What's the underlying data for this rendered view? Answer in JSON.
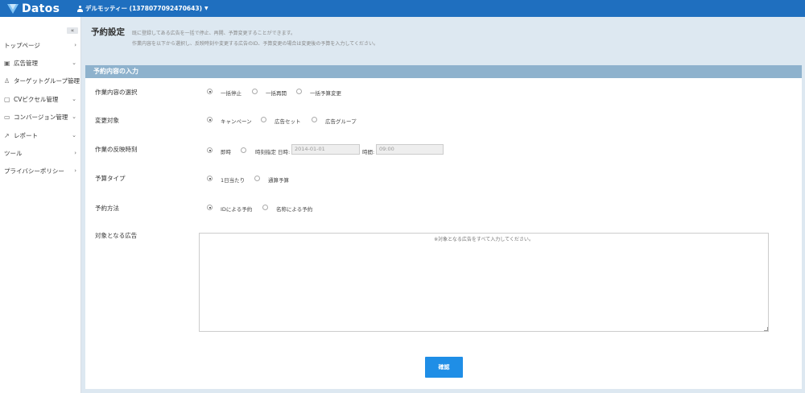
{
  "header": {
    "logo_text": "Datos",
    "account_label": "デルモッティー (1378077092470643)"
  },
  "sidebar": {
    "collapse_label": "«",
    "items": [
      {
        "label": "トップページ",
        "icon": "none"
      },
      {
        "label": "広告管理",
        "icon": "ad-icon"
      },
      {
        "label": "ターゲットグループ管理",
        "icon": "user-icon"
      },
      {
        "label": "CVピクセル管理",
        "icon": "pixel-icon"
      },
      {
        "label": "コンバージョン管理",
        "icon": "conversion-icon"
      },
      {
        "label": "レポート",
        "icon": "chart-icon"
      },
      {
        "label": "ツール",
        "icon": "none"
      },
      {
        "label": "プライバシーポリシー",
        "icon": "none"
      }
    ]
  },
  "page": {
    "title": "予約設定",
    "desc_line1": "既に登録してある広告を一括で停止、再開、予算変更することができます。",
    "desc_line2": "作業内容を以下から選択し、反映時刻や変更する広告のID、予算変更の場合は変更後の予算を入力してください。"
  },
  "form": {
    "panel_title": "予約内容の入力",
    "rows": {
      "task": {
        "label": "作業内容の選択",
        "options": [
          "一括停止",
          "一括再開",
          "一括予算変更"
        ],
        "selected": 0
      },
      "target": {
        "label": "変更対象",
        "options": [
          "キャンペーン",
          "広告セット",
          "広告グループ"
        ],
        "selected": 0
      },
      "timing": {
        "label": "作業の反映時刻",
        "options": [
          "即時",
          "時刻指定"
        ],
        "selected": 0,
        "date_label": "日時:",
        "date_value": "2014-01-01",
        "time_label": "時間:",
        "time_value": "09:00"
      },
      "budget_type": {
        "label": "予算タイプ",
        "options": [
          "1日当たり",
          "通算予算"
        ],
        "selected": 0
      },
      "method": {
        "label": "予約方法",
        "options": [
          "IDによる予約",
          "名称による予約"
        ],
        "selected": 0
      },
      "ads": {
        "label": "対象となる広告",
        "placeholder": "※対象となる広告をすべて入力してください。"
      }
    },
    "confirm_label": "確認"
  },
  "colors": {
    "topbar": "#1f6fbf",
    "panel_header": "#8eb2cd",
    "button": "#1f8ee6",
    "page_bg": "#dde8f1"
  }
}
